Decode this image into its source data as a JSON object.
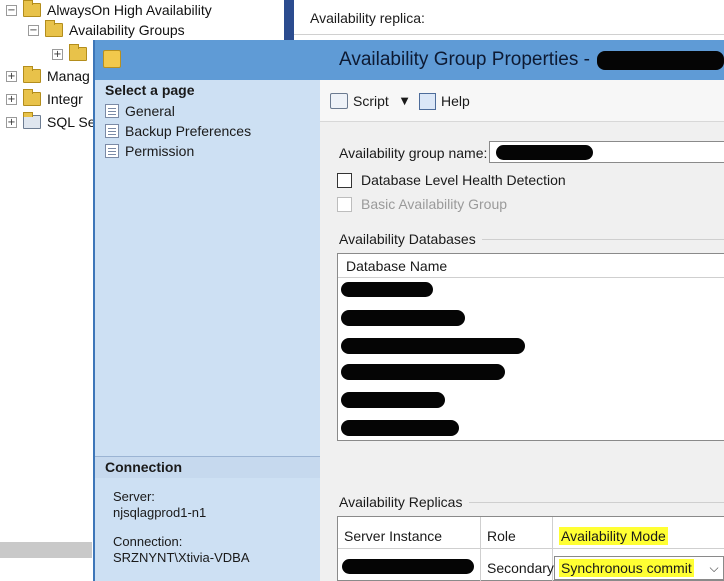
{
  "background": {
    "tree": {
      "alwayson": "AlwaysOn High Availability",
      "availability_groups": "Availability Groups",
      "manage_partial": "Manag",
      "integration_partial": "Integr",
      "sql_partial": "SQL Se",
      "expander_symbols": {
        "collapse": "−",
        "expand": "+"
      }
    },
    "right_label": "Availability replica:"
  },
  "dialog": {
    "title": "Availability Group Properties -",
    "left_pane": {
      "select_page": "Select a page",
      "pages": [
        {
          "label": "General"
        },
        {
          "label": "Backup Preferences"
        },
        {
          "label": "Permission"
        }
      ],
      "connection_title": "Connection",
      "server_label": "Server:",
      "server_value": "njsqlagprod1-n1",
      "connection_label": "Connection:",
      "connection_value": "SRZNYNT\\Xtivia-VDBA"
    },
    "toolbar": {
      "script_label": "Script",
      "help_label": "Help",
      "dropdown_symbol": "▼"
    },
    "general": {
      "ag_name_label": "Availability group name:",
      "db_health_label": "Database Level Health Detection",
      "basic_ag_label": "Basic Availability Group",
      "databases_group": "Availability Databases",
      "db_column": "Database Name",
      "replicas_group": "Availability Replicas",
      "replica_columns": [
        "Server Instance",
        "Role",
        "Availability Mode"
      ],
      "replica_row": {
        "role": "Secondary",
        "mode": "Synchronous commit"
      },
      "chevron": "⌵"
    }
  },
  "colors": {
    "titlebar": "#5f9bd6",
    "left_pane": "#cde0f3",
    "highlight": "#ffff33"
  }
}
